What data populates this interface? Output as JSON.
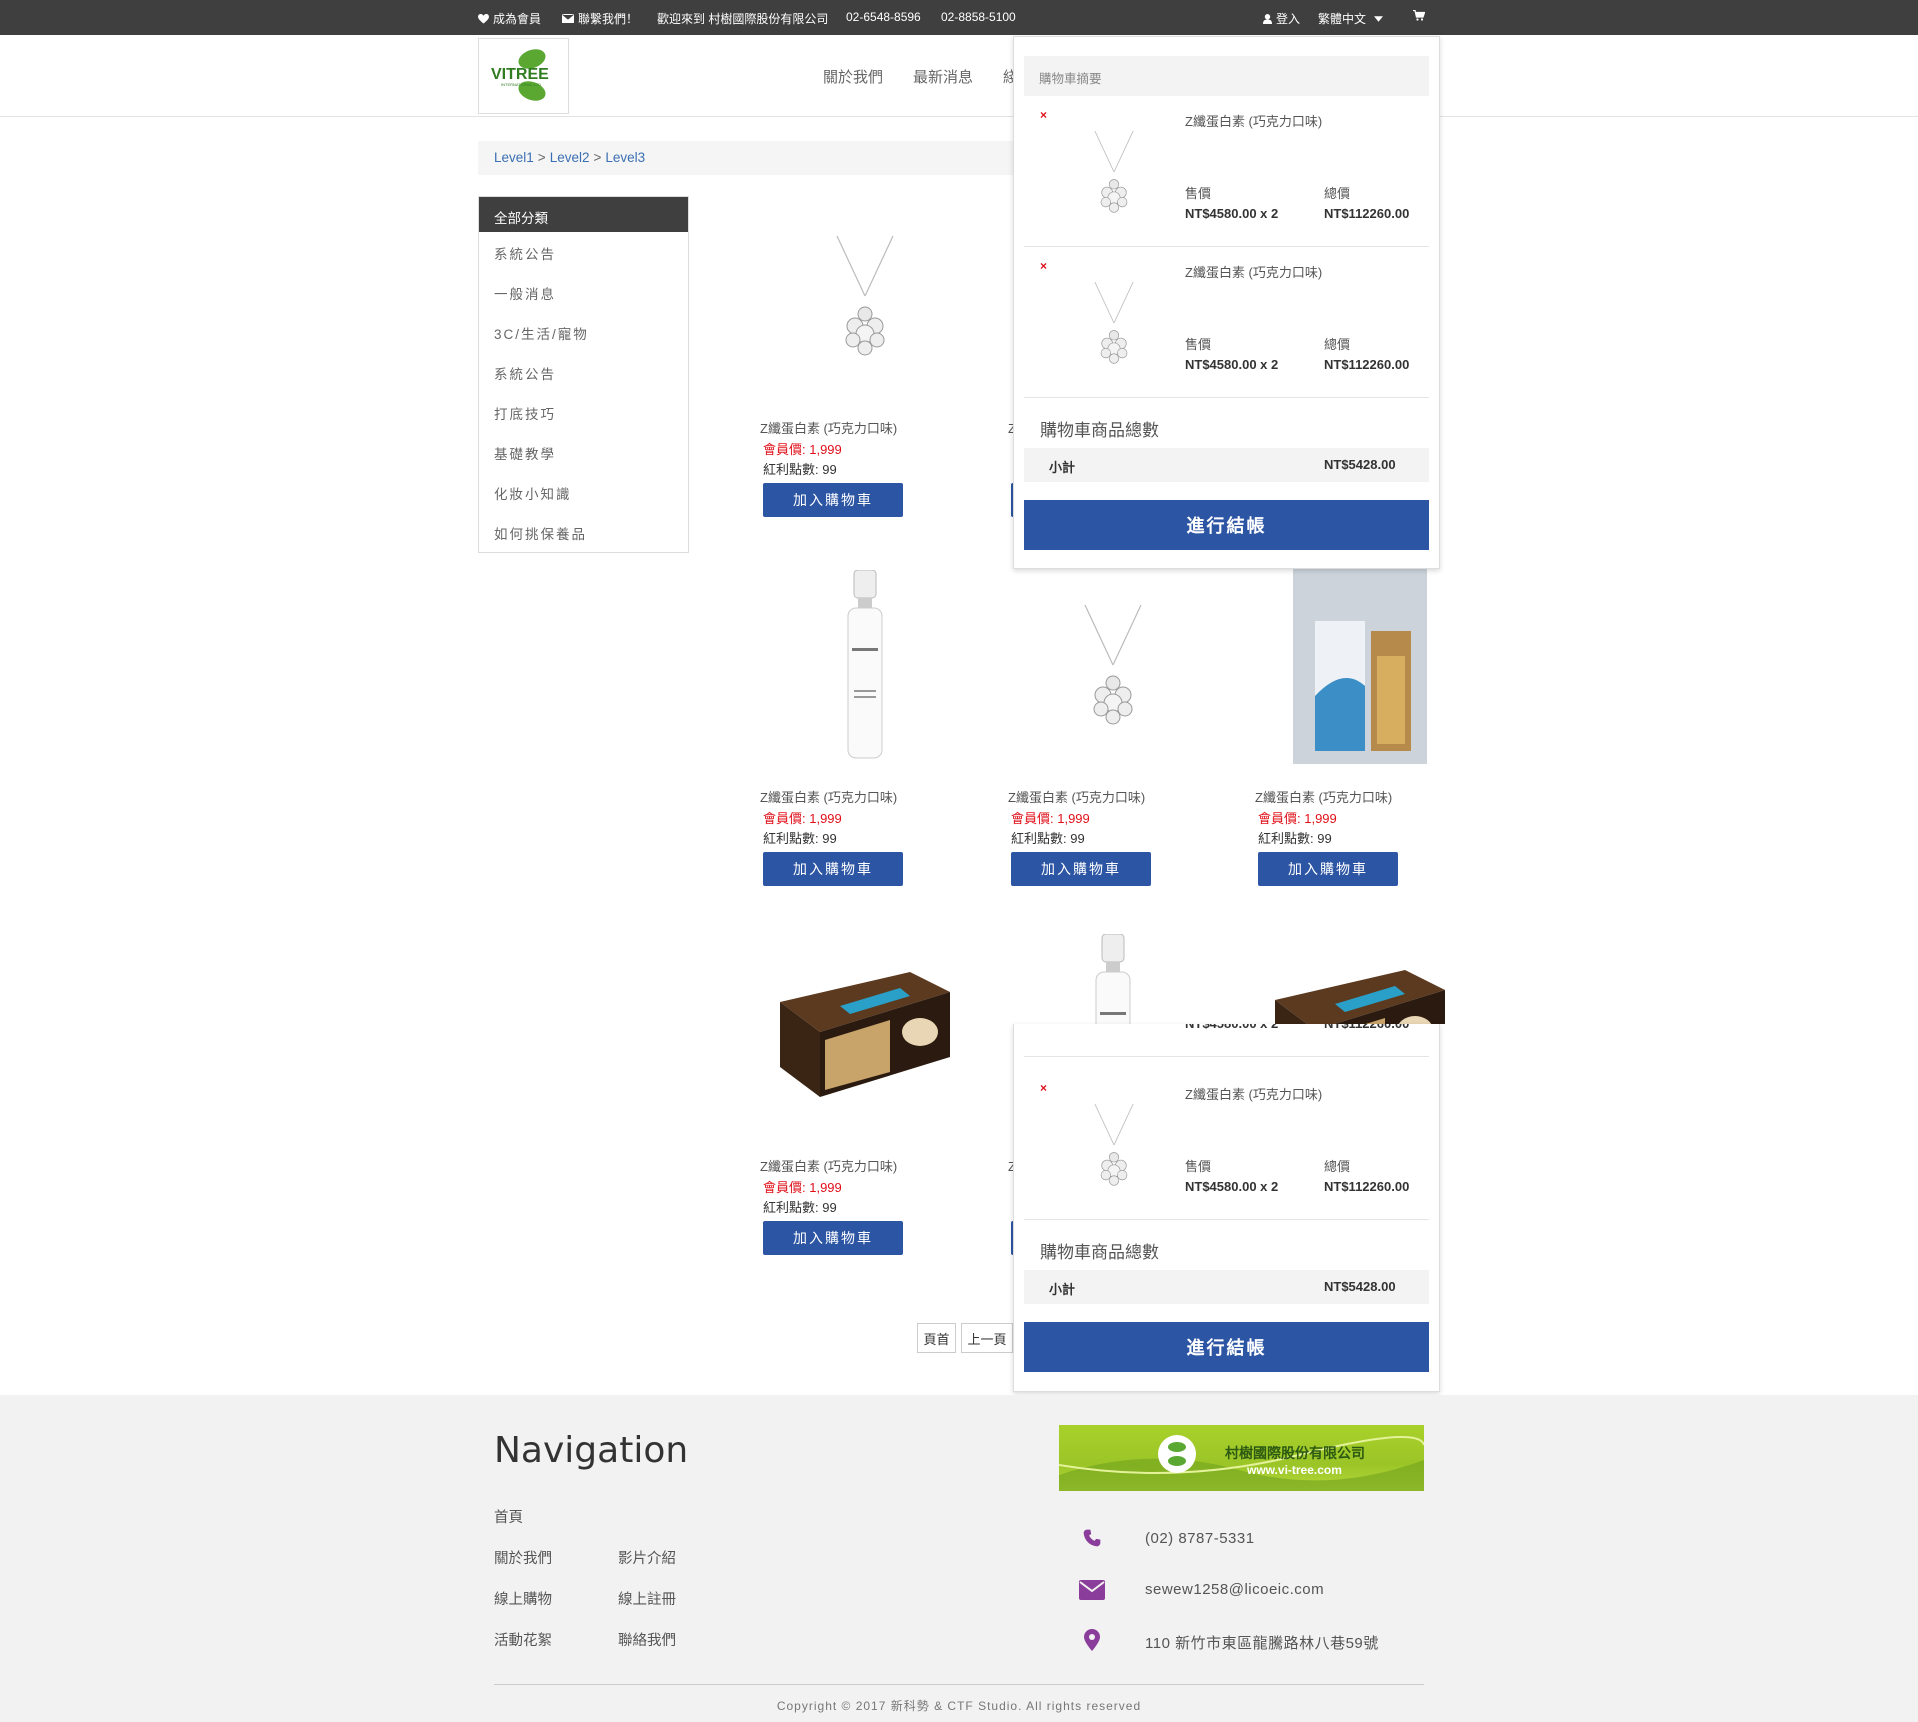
{
  "topbar": {
    "join": "成為會員",
    "contact": "聯繫我們！",
    "welcome": "歡迎來到 村樹國際股份有限公司",
    "phone1": "02-6548-8596",
    "phone2": "02-8858-5100",
    "login": "登入",
    "language": "繁體中文"
  },
  "header": {
    "logo_text": "VITREE",
    "logo_sub": "INTERNATIONAL,LTD",
    "nav": [
      "關於我們",
      "最新消息",
      "綫"
    ]
  },
  "breadcrumb": [
    "Level1",
    "Level2",
    "Level3"
  ],
  "breadcrumb_sep": ">",
  "sidebar": {
    "title": "全部分類",
    "categories": [
      "系統公告",
      "一般消息",
      "3C/生活/寵物",
      "系統公告",
      "打底技巧",
      "基礎教學",
      "化妝小知識",
      "如何挑保養品"
    ]
  },
  "product": {
    "name": "Z纖蛋白素 (巧克力口味)",
    "price": "會員價: 1,999",
    "points": "紅利點數: 99",
    "add_label": "加入購物車"
  },
  "pagination": {
    "first": "頁首",
    "prev": "上一頁"
  },
  "cart": {
    "summary_label": "購物車摘要",
    "remove": "×",
    "item_name": "Z纖蛋白素 (巧克力口味)",
    "unit_label": "售價",
    "total_label": "總價",
    "unit_value": "NT$4580.00 x 2",
    "total_value": "NT$112260.00",
    "count_label": "購物車商品總數",
    "subtotal_label": "小計",
    "subtotal_value": "NT$5428.00",
    "checkout": "進行結帳"
  },
  "footer": {
    "title": "Navigation",
    "links": [
      "首頁",
      "關於我們",
      "影片介紹",
      "線上購物",
      "線上註冊",
      "活動花絮",
      "聯絡我們"
    ],
    "banner_name": "村樹國際股份有限公司",
    "banner_url": "www.vi-tree.com",
    "phone": "(02) 8787-5331",
    "email": "sewew1258@licoeic.com",
    "address": "110 新竹市東區龍騰路林八巷59號",
    "copyright": "Copyright © 2017 新科勢 & CTF Studio. All rights reserved"
  },
  "colors": {
    "topbar": "#3f3f3f",
    "button_blue": "#2c55a3",
    "price_red": "#e0101a",
    "footer_icon": "#8a3d9a",
    "link_blue": "#3a6fb3"
  }
}
